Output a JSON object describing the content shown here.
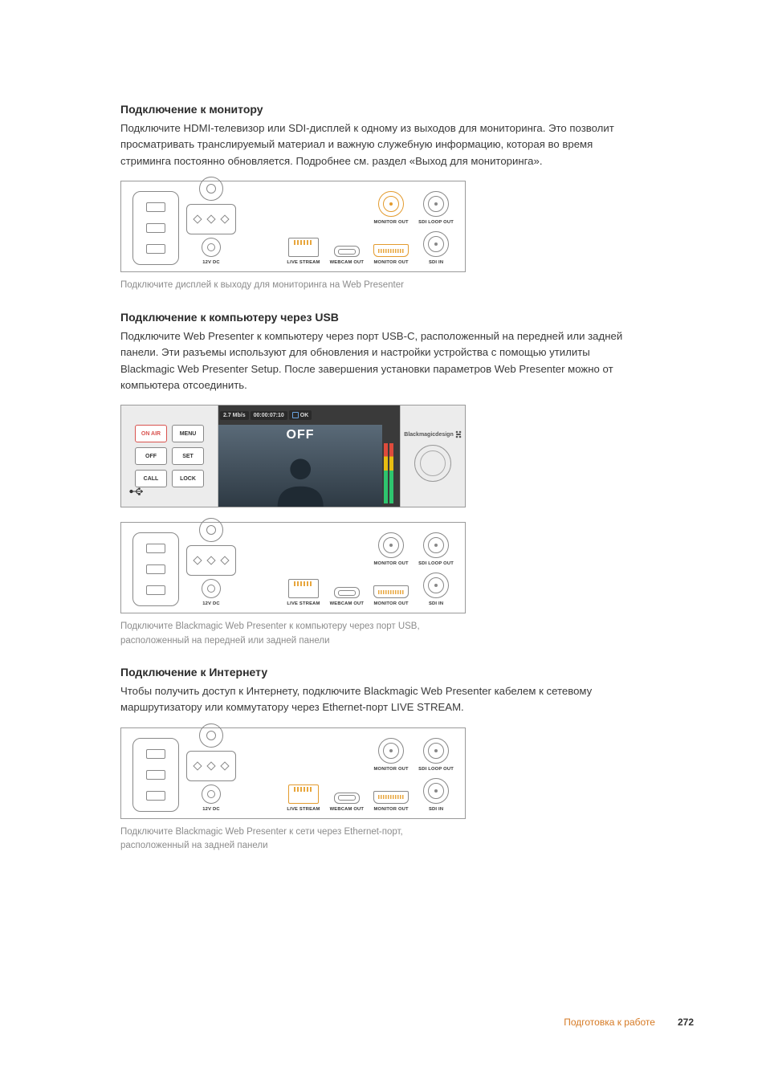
{
  "sections": {
    "monitor": {
      "heading": "Подключение к монитору",
      "body": "Подключите HDMI-телевизор или SDI-дисплей к одному из выходов для мониторинга. Это позволит просматривать транслируемый материал и важную служебную информацию, которая во время стриминга постоянно обновляется. Подробнее см. раздел «Выход для мониторинга».",
      "caption": "Подключите дисплей к выходу для мониторинга на Web Presenter"
    },
    "usb": {
      "heading": "Подключение к компьютеру через USB",
      "body": "Подключите Web Presenter к компьютеру через порт USB-C, расположенный на передней или задней панели. Эти разъемы используют для обновления и настройки устройства с помощью утилиты Blackmagic Web Presenter Setup. После завершения установки параметров Web Presenter можно от компьютера отсоединить.",
      "caption": "Подключите Blackmagic Web Presenter к компьютеру через порт USB, расположенный на передней или задней панели"
    },
    "internet": {
      "heading": "Подключение к Интернету",
      "body": "Чтобы получить доступ к Интернету, подключите Blackmagic Web Presenter кабелем к сетевому маршрутизатору или коммутатору через Ethernet-порт LIVE STREAM.",
      "caption": "Подключите Blackmagic Web Presenter к сети через Ethernet-порт, расположенный на задней панели"
    }
  },
  "rear_panel": {
    "dc_label": "12V DC",
    "live_stream": "LIVE STREAM",
    "webcam_out": "WEBCAM OUT",
    "monitor_out": "MONITOR OUT",
    "sdi_loop_out": "SDI LOOP OUT",
    "sdi_in": "SDI IN"
  },
  "front_panel": {
    "buttons": {
      "on_air": "ON AIR",
      "menu": "MENU",
      "off": "OFF",
      "set": "SET",
      "call": "CALL",
      "lock": "LOCK"
    },
    "lcd": {
      "bitrate": "2.7 Mb/s",
      "timecode": "00:00:07:10",
      "status": "OK",
      "state": "OFF"
    },
    "brand": "Blackmagicdesign"
  },
  "footer": {
    "section": "Подготовка к работе",
    "page": "272"
  }
}
